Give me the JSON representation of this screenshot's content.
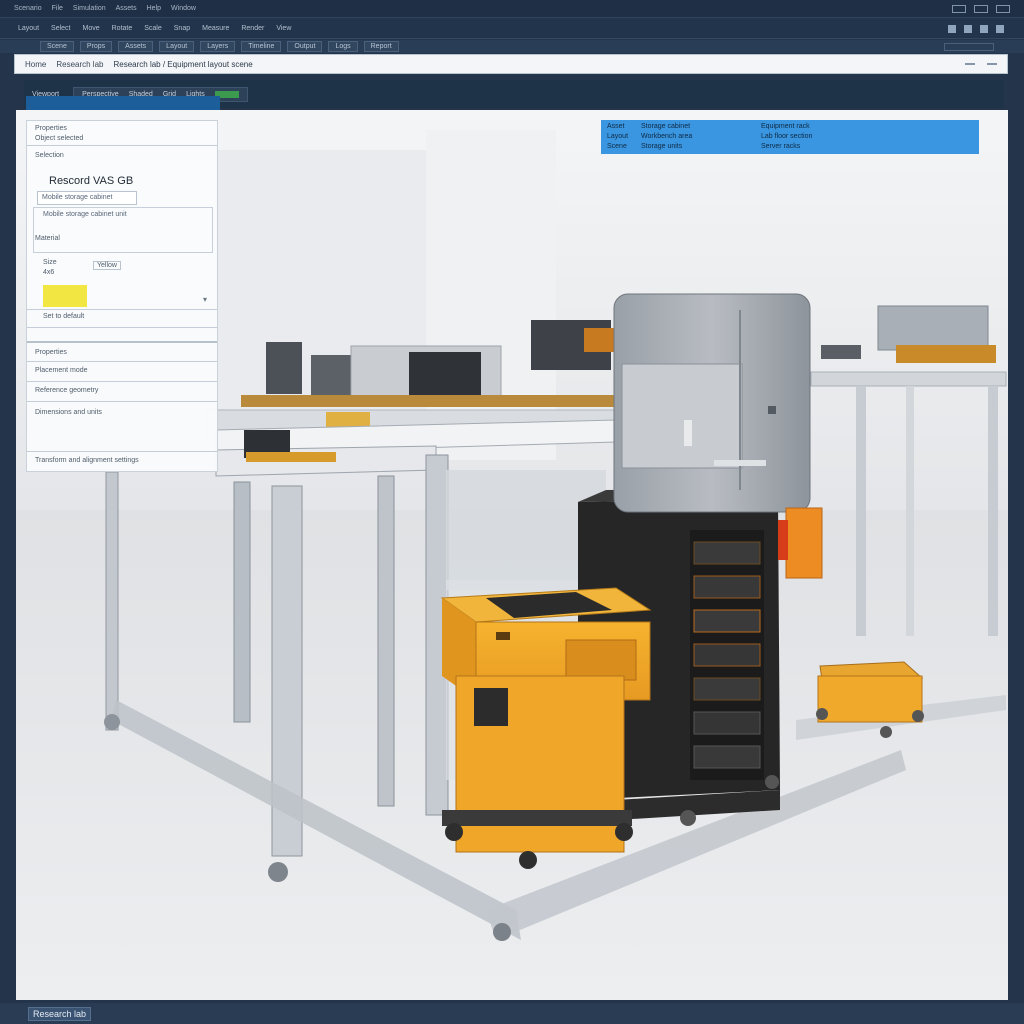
{
  "menu": {
    "items": [
      "Scenario",
      "File",
      "Simulation",
      "Assets",
      "Help",
      "Window"
    ]
  },
  "toolbar": {
    "items": [
      "Layout",
      "Select",
      "Move",
      "Rotate",
      "Scale",
      "Snap",
      "Measure",
      "Render",
      "View"
    ]
  },
  "tabs": [
    "Scene",
    "Props",
    "Assets",
    "Layout",
    "Layers",
    "Timeline",
    "Output",
    "Logs",
    "Report"
  ],
  "address_bar": {
    "crumb": "Home",
    "location": "Research lab",
    "path": "Research lab / Equipment layout scene"
  },
  "subtoolbar": {
    "label": "Viewport",
    "items": [
      "Perspective",
      "Shaded",
      "Grid",
      "Lights"
    ]
  },
  "properties_panel": {
    "header_line1": "Properties",
    "header_line2": "Object selected",
    "section_label": "Selection",
    "title": "Rescord VAS GB",
    "field_name": "Mobile storage cabinet",
    "field_description": "Mobile storage cabinet unit",
    "layer_label": "Material",
    "dim_label": "Size",
    "dim_value": "4x6",
    "color_label": "Yellow",
    "footer_field": "Set to default",
    "section2_label": "Properties",
    "section2_rows": [
      "Placement mode",
      "Reference geometry",
      "Dimensions and units"
    ],
    "section2_footer": "Transform and alignment settings"
  },
  "info_banner": {
    "line1_left": "Asset",
    "line1_mid": "Storage cabinet",
    "line1_right": "Equipment rack",
    "line2_left": "Layout",
    "line2_mid": "Workbench area",
    "line2_right": "Lab floor section",
    "line3_left": "Scene",
    "line3_mid": "Storage units",
    "line3_right": "Server racks"
  },
  "status_bar": {
    "text": "Research lab"
  },
  "colors": {
    "chrome": "#1f2f45",
    "accent_blue": "#3a96e0",
    "cabinet_yellow": "#f1a92b",
    "rack_black": "#262626",
    "swatch_yellow": "#f2e642"
  }
}
